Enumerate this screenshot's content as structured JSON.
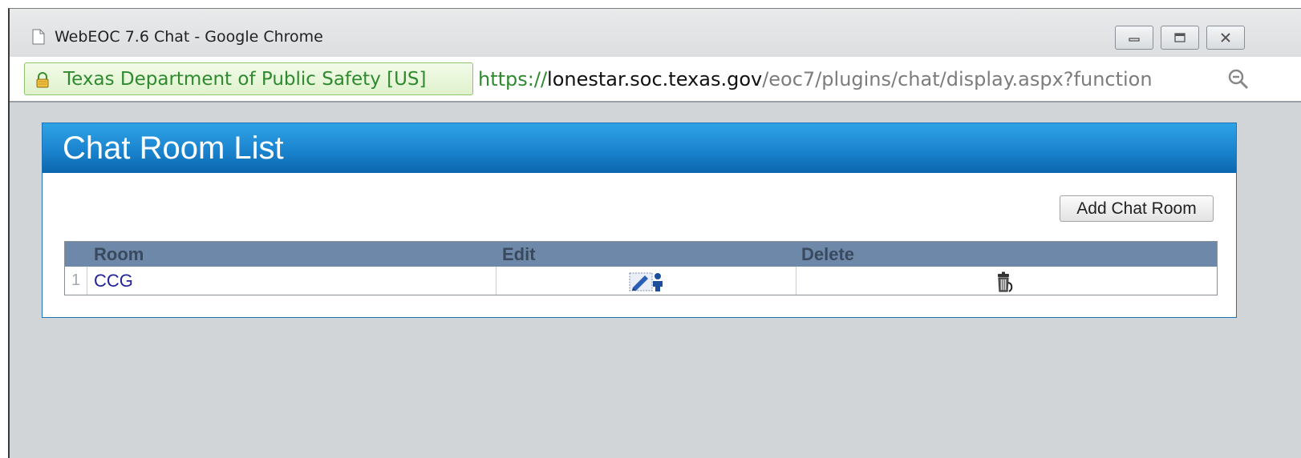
{
  "browser": {
    "title": "WebEOC 7.6  Chat - Google Chrome",
    "ev_org": "Texas Department of Public Safety [US]",
    "url_scheme": "https://",
    "url_host": "lonestar.soc.texas.gov",
    "url_path": "/eoc7/plugins/chat/display.aspx?function",
    "icons": {
      "page": "page-icon",
      "lock": "lock-icon",
      "zoom": "zoom-icon",
      "minimize": "minimize-icon",
      "maximize": "maximize-icon",
      "close": "close-icon"
    }
  },
  "panel": {
    "title": "Chat Room List",
    "add_button_label": "Add Chat Room",
    "columns": [
      "Room",
      "Edit",
      "Delete"
    ],
    "rows": [
      {
        "num": "1",
        "room": "CCG",
        "edit_icon": "edit-icon",
        "delete_icon": "trash-icon"
      }
    ]
  },
  "colors": {
    "header_blue": "#1b84cf",
    "grid_header": "#6e88a9",
    "link": "#23239a",
    "ev_green": "#2f8a2f"
  }
}
